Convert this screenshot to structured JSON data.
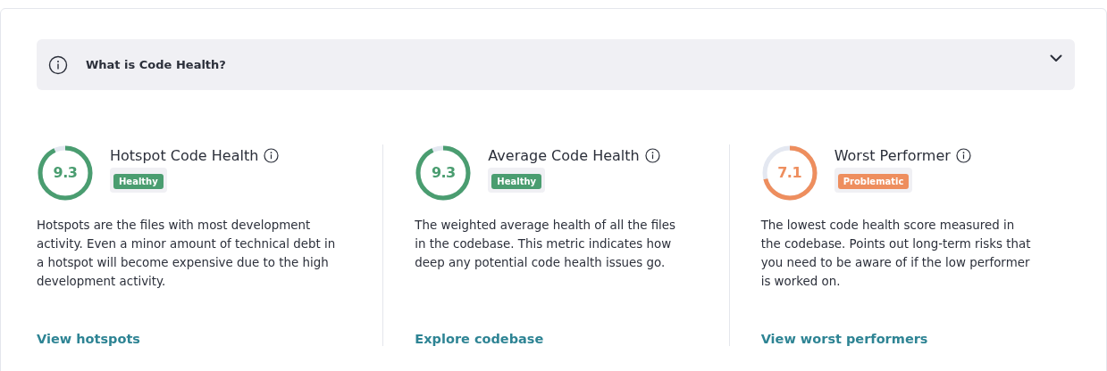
{
  "accordion": {
    "title": "What is Code Health?",
    "expanded": false
  },
  "metrics": [
    {
      "title": "Hotspot Code Health",
      "score": "9.3",
      "level": 0.93,
      "color": "#4a9d70",
      "badge": "Healthy",
      "description": "Hotspots are the files with most development activity. Even a minor amount of technical debt in a hotspot will become expensive due to the high development activity.",
      "link": "View hotspots"
    },
    {
      "title": "Average Code Health",
      "score": "9.3",
      "level": 0.93,
      "color": "#4a9d70",
      "badge": "Healthy",
      "description": "The weighted average health of all the files in the codebase. This metric indicates how deep any potential code health issues go.",
      "link": "Explore codebase"
    },
    {
      "title": "Worst Performer",
      "score": "7.1",
      "level": 0.71,
      "color": "#ee8e5e",
      "badge": "Problematic",
      "description": "The lowest code health score measured in the codebase. Points out long-term risks that you need to be aware of if the low performer is worked on.",
      "link": "View worst performers"
    }
  ]
}
